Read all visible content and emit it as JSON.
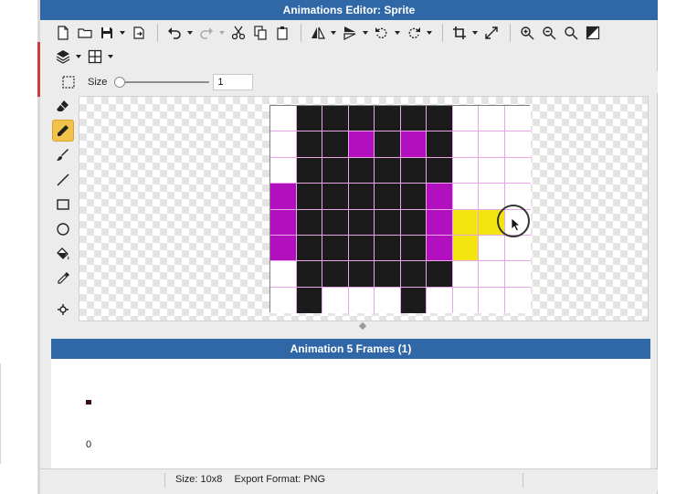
{
  "window": {
    "title": "Animations Editor: Sprite"
  },
  "toolbar": {
    "row1": [
      {
        "icon": "new-file-icon"
      },
      {
        "icon": "open-folder-icon"
      },
      {
        "icon": "save-icon",
        "dropdown": true
      },
      {
        "icon": "export-icon"
      },
      {
        "separator": true
      },
      {
        "icon": "undo-icon",
        "dropdown": true
      },
      {
        "icon": "redo-icon",
        "dropdown": true,
        "disabled": true
      },
      {
        "icon": "cut-icon"
      },
      {
        "icon": "copy-icon"
      },
      {
        "icon": "paste-icon"
      },
      {
        "separator": true
      },
      {
        "icon": "flip-horizontal-icon",
        "dropdown": true
      },
      {
        "icon": "flip-vertical-icon",
        "dropdown": true
      },
      {
        "icon": "rotate-ccw-icon",
        "dropdown": true
      },
      {
        "icon": "rotate-cw-icon",
        "dropdown": true
      },
      {
        "separator": true
      },
      {
        "icon": "crop-icon",
        "dropdown": true
      },
      {
        "icon": "resize-icon"
      },
      {
        "separator": true
      },
      {
        "icon": "zoom-in-icon"
      },
      {
        "icon": "zoom-out-icon"
      },
      {
        "icon": "zoom-fit-icon"
      },
      {
        "icon": "toggle-transparency-icon"
      }
    ],
    "row2": [
      {
        "icon": "layers-icon",
        "dropdown": true
      },
      {
        "icon": "grid-icon",
        "dropdown": true
      }
    ]
  },
  "options": {
    "size_label": "Size",
    "size_value": "1",
    "size_slider_fraction": 0.0
  },
  "side_tools": [
    {
      "icon": "eraser-icon",
      "active": false
    },
    {
      "icon": "pencil-icon",
      "active": true
    },
    {
      "icon": "brush-icon",
      "active": false
    },
    {
      "icon": "line-icon",
      "active": false
    },
    {
      "icon": "rectangle-icon",
      "active": false
    },
    {
      "icon": "ellipse-icon",
      "active": false
    },
    {
      "icon": "paint-bucket-icon",
      "active": false
    },
    {
      "icon": "eyedropper-icon",
      "active": false
    },
    {
      "icon": "anchor-point-icon",
      "active": false
    }
  ],
  "colors": {
    "accent": "#2f67a7",
    "black": "#1b1b1b",
    "magenta": "#b20fbf",
    "yellow": "#f3e610",
    "empty": "#ffffff",
    "grid_line": "#e7a6e7",
    "active_tool": "#f2c34a"
  },
  "sprite": {
    "width": 10,
    "height": 8,
    "palette": {
      "0": "empty",
      "1": "black",
      "2": "magenta",
      "3": "yellow"
    },
    "pixels": [
      "0111111000",
      "0112121000",
      "0111111000",
      "2111112000",
      "2111112330",
      "2111112300",
      "0111111000",
      "0100010000"
    ]
  },
  "animation": {
    "header": "Animation 5 Frames (1)",
    "frames": [
      {
        "index": "0"
      }
    ]
  },
  "status": {
    "size": "Size: 10x8",
    "export_format": "Export Format: PNG"
  }
}
